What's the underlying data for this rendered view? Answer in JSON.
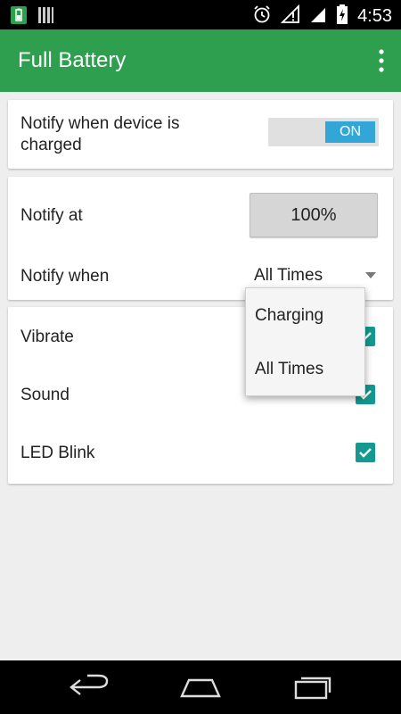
{
  "status_bar": {
    "time": "4:53",
    "icons": [
      "battery-app-icon",
      "signal-bars-icon",
      "alarm-icon",
      "wifi-icon",
      "cell-signal-icon",
      "battery-charging-icon"
    ]
  },
  "app_bar": {
    "title": "Full Battery",
    "overflow_icon": "more-vert-icon"
  },
  "notify_card": {
    "label": "Notify when device is charged",
    "toggle_label": "ON",
    "toggle_state": true
  },
  "settings_card": {
    "notify_at_label": "Notify at",
    "notify_at_value": "100%",
    "notify_when_label": "Notify when",
    "notify_when_value": "All Times"
  },
  "alerts_card": {
    "vibrate_label": "Vibrate",
    "vibrate_checked": true,
    "sound_label": "Sound",
    "sound_checked": true,
    "led_label": "LED Blink",
    "led_checked": true
  },
  "dropdown": {
    "options": [
      "Charging",
      "All Times"
    ]
  },
  "colors": {
    "app_bar": "#2e9e4f",
    "toggle_on": "#33a6d8",
    "checkbox": "#139990",
    "background": "#eeeeee"
  },
  "nav_bar": {
    "icons": [
      "back-icon",
      "home-icon",
      "recent-apps-icon"
    ]
  }
}
